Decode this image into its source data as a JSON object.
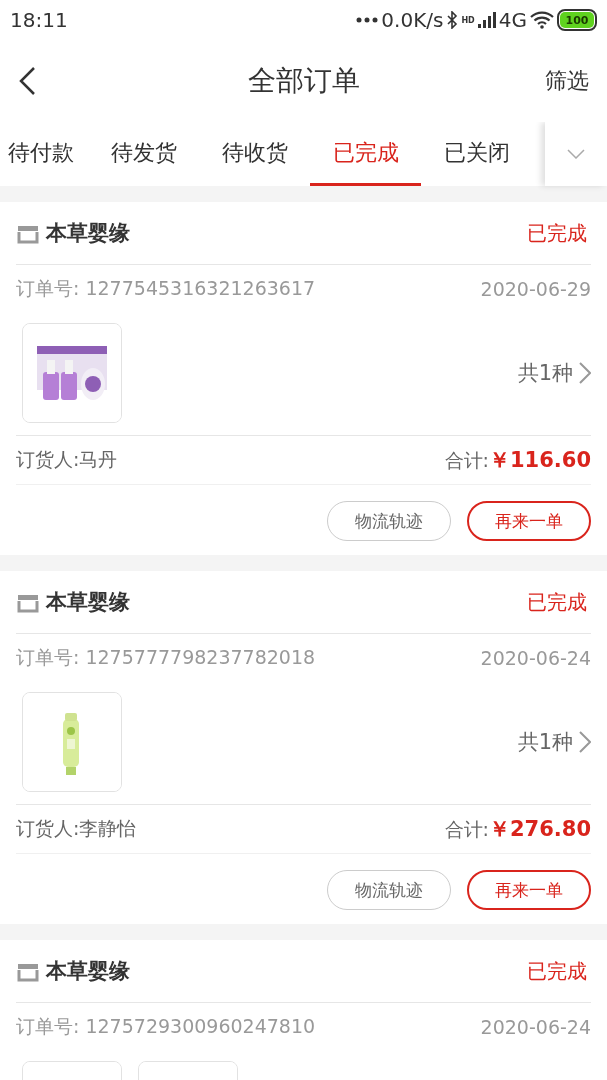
{
  "status_bar": {
    "time": "18:11",
    "speed": "0.0K/s",
    "hd": "HD",
    "network": "4G",
    "battery": "100"
  },
  "nav": {
    "title": "全部订单",
    "action": "筛选"
  },
  "tabs": [
    {
      "label": "待付款",
      "selected": false
    },
    {
      "label": "待发货",
      "selected": false
    },
    {
      "label": "待收货",
      "selected": false
    },
    {
      "label": "已完成",
      "selected": true
    },
    {
      "label": "已关闭",
      "selected": false
    }
  ],
  "orders": [
    {
      "shop": "本草婴缘",
      "status": "已完成",
      "order_no": "订单号: 1277545316321263617",
      "date": "2020-06-29",
      "products": [
        {
          "kind": "picture"
        }
      ],
      "count": "共1种",
      "buyer": "订货人:马丹",
      "total_label": "合计:",
      "total": "￥116.60",
      "buttons": [
        {
          "label": "物流轨迹",
          "kind": "secondary"
        },
        {
          "label": "再来一单",
          "kind": "primary"
        }
      ]
    },
    {
      "shop": "本草婴缘",
      "status": "已完成",
      "order_no": "订单号: 1275777798237782018",
      "date": "2020-06-24",
      "products": [
        {
          "kind": "picture"
        }
      ],
      "count": "共1种",
      "buyer": "订货人:李静怡",
      "total_label": "合计:",
      "total": "￥276.80",
      "buttons": [
        {
          "label": "物流轨迹",
          "kind": "secondary"
        },
        {
          "label": "再来一单",
          "kind": "primary"
        }
      ]
    },
    {
      "shop": "本草婴缘",
      "status": "已完成",
      "order_no": "订单号: 1275729300960247810",
      "date": "2020-06-24",
      "products": [
        {
          "kind": "picture"
        },
        {
          "kind": "picture"
        }
      ]
    }
  ]
}
